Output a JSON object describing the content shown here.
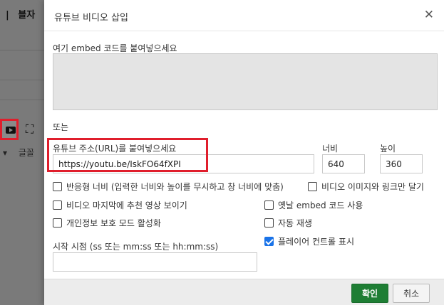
{
  "background": {
    "menu_items": [
      "|",
      "블자",
      "|"
    ],
    "font_label": "글꼴",
    "font_caret": "▾"
  },
  "dialog": {
    "title": "유튜브 비디오 삽입",
    "close_symbol": "✕",
    "embed_label": "여기 embed 코드를 붙여넣으세요",
    "embed_value": "",
    "or_label": "또는",
    "url_label": "유튜브 주소(URL)를 붙여넣으세요",
    "url_value": "https://youtu.be/IskFO64fXPI",
    "width_label": "너비",
    "width_value": "640",
    "height_label": "높이",
    "height_value": "360",
    "options": [
      {
        "label": "반응형 너비 (입력한 너비와 높이를 무시하고 창 너비에 맞춤)",
        "checked": false
      },
      {
        "label": "비디오 이미지와 링크만 달기",
        "checked": false
      },
      {
        "label": "비디오 마지막에 추천 영상 보이기",
        "checked": false
      },
      {
        "label": "옛날 embed 코드 사용",
        "checked": false
      },
      {
        "label": "개인정보 보호 모드 활성화",
        "checked": false
      },
      {
        "label": "자동 재생",
        "checked": false
      },
      {
        "label": "플레이어 컨트롤 표시",
        "checked": true
      }
    ],
    "start_label": "시작 시점 (ss 또는 mm:ss 또는 hh:mm:ss)",
    "start_value": "",
    "ok_label": "확인",
    "cancel_label": "취소"
  },
  "colors": {
    "ok_button": "#1e7e34",
    "highlight": "#e01e2c",
    "checkbox_checked": "#1a73e8"
  }
}
